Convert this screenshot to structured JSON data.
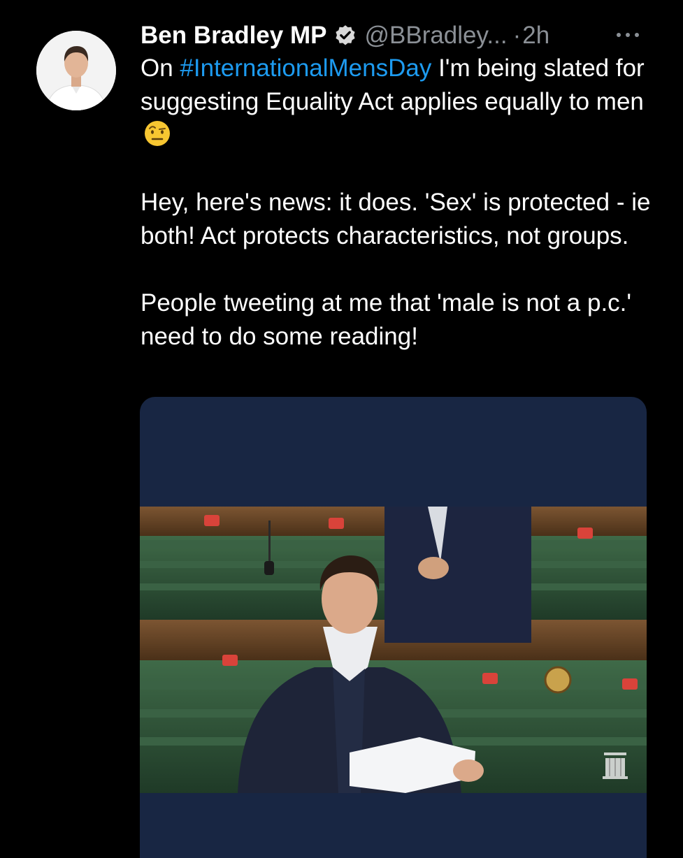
{
  "tweet": {
    "author_name": "Ben Bradley MP",
    "handle": "@BBradley...",
    "separator": "·",
    "timestamp": "2h",
    "more_icon": "more-horizontal-icon",
    "verified_icon": "verified-badge-icon",
    "line1_prefix": "On ",
    "hashtag": "#InternationalMensDay",
    "line1_suffix": " I'm being slated for suggesting Equality Act applies equally to men",
    "emoji": "raised-eyebrow-face",
    "paragraph2": "Hey, here's news: it does. 'Sex' is protected - ie both! Act protects characteristics, not groups.",
    "paragraph3": "People tweeting at me that 'male is not a p.c.' need to do some reading!"
  },
  "colors": {
    "background": "#000000",
    "text": "#ffffff",
    "muted": "#8b9096",
    "link": "#1d9bf0",
    "media_background": "#182643"
  }
}
